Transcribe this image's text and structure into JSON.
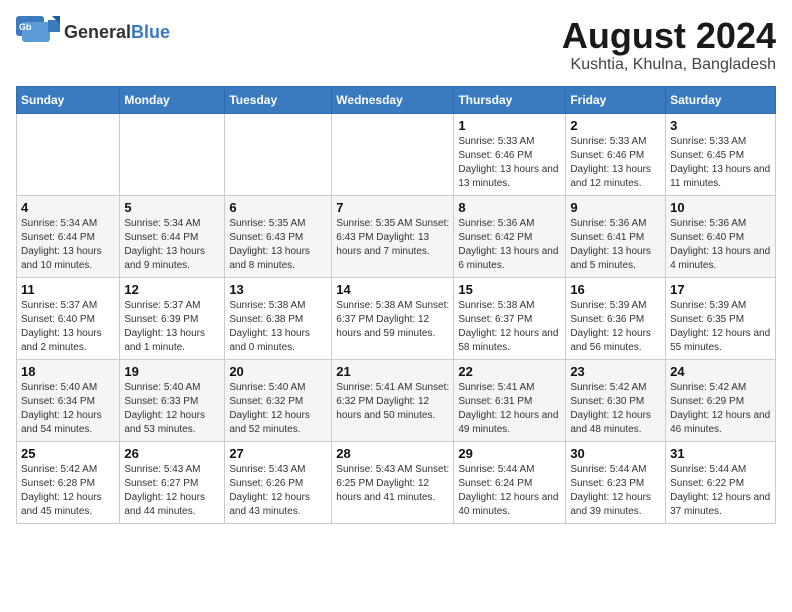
{
  "header": {
    "logo_line1": "General",
    "logo_line2": "Blue",
    "main_title": "August 2024",
    "subtitle": "Kushtia, Khulna, Bangladesh"
  },
  "days_of_week": [
    "Sunday",
    "Monday",
    "Tuesday",
    "Wednesday",
    "Thursday",
    "Friday",
    "Saturday"
  ],
  "weeks": [
    [
      {
        "date": "",
        "info": ""
      },
      {
        "date": "",
        "info": ""
      },
      {
        "date": "",
        "info": ""
      },
      {
        "date": "",
        "info": ""
      },
      {
        "date": "1",
        "info": "Sunrise: 5:33 AM\nSunset: 6:46 PM\nDaylight: 13 hours\nand 13 minutes."
      },
      {
        "date": "2",
        "info": "Sunrise: 5:33 AM\nSunset: 6:46 PM\nDaylight: 13 hours\nand 12 minutes."
      },
      {
        "date": "3",
        "info": "Sunrise: 5:33 AM\nSunset: 6:45 PM\nDaylight: 13 hours\nand 11 minutes."
      }
    ],
    [
      {
        "date": "4",
        "info": "Sunrise: 5:34 AM\nSunset: 6:44 PM\nDaylight: 13 hours\nand 10 minutes."
      },
      {
        "date": "5",
        "info": "Sunrise: 5:34 AM\nSunset: 6:44 PM\nDaylight: 13 hours\nand 9 minutes."
      },
      {
        "date": "6",
        "info": "Sunrise: 5:35 AM\nSunset: 6:43 PM\nDaylight: 13 hours\nand 8 minutes."
      },
      {
        "date": "7",
        "info": "Sunrise: 5:35 AM\nSunset: 6:43 PM\nDaylight: 13 hours\nand 7 minutes."
      },
      {
        "date": "8",
        "info": "Sunrise: 5:36 AM\nSunset: 6:42 PM\nDaylight: 13 hours\nand 6 minutes."
      },
      {
        "date": "9",
        "info": "Sunrise: 5:36 AM\nSunset: 6:41 PM\nDaylight: 13 hours\nand 5 minutes."
      },
      {
        "date": "10",
        "info": "Sunrise: 5:36 AM\nSunset: 6:40 PM\nDaylight: 13 hours\nand 4 minutes."
      }
    ],
    [
      {
        "date": "11",
        "info": "Sunrise: 5:37 AM\nSunset: 6:40 PM\nDaylight: 13 hours\nand 2 minutes."
      },
      {
        "date": "12",
        "info": "Sunrise: 5:37 AM\nSunset: 6:39 PM\nDaylight: 13 hours\nand 1 minute."
      },
      {
        "date": "13",
        "info": "Sunrise: 5:38 AM\nSunset: 6:38 PM\nDaylight: 13 hours\nand 0 minutes."
      },
      {
        "date": "14",
        "info": "Sunrise: 5:38 AM\nSunset: 6:37 PM\nDaylight: 12 hours\nand 59 minutes."
      },
      {
        "date": "15",
        "info": "Sunrise: 5:38 AM\nSunset: 6:37 PM\nDaylight: 12 hours\nand 58 minutes."
      },
      {
        "date": "16",
        "info": "Sunrise: 5:39 AM\nSunset: 6:36 PM\nDaylight: 12 hours\nand 56 minutes."
      },
      {
        "date": "17",
        "info": "Sunrise: 5:39 AM\nSunset: 6:35 PM\nDaylight: 12 hours\nand 55 minutes."
      }
    ],
    [
      {
        "date": "18",
        "info": "Sunrise: 5:40 AM\nSunset: 6:34 PM\nDaylight: 12 hours\nand 54 minutes."
      },
      {
        "date": "19",
        "info": "Sunrise: 5:40 AM\nSunset: 6:33 PM\nDaylight: 12 hours\nand 53 minutes."
      },
      {
        "date": "20",
        "info": "Sunrise: 5:40 AM\nSunset: 6:32 PM\nDaylight: 12 hours\nand 52 minutes."
      },
      {
        "date": "21",
        "info": "Sunrise: 5:41 AM\nSunset: 6:32 PM\nDaylight: 12 hours\nand 50 minutes."
      },
      {
        "date": "22",
        "info": "Sunrise: 5:41 AM\nSunset: 6:31 PM\nDaylight: 12 hours\nand 49 minutes."
      },
      {
        "date": "23",
        "info": "Sunrise: 5:42 AM\nSunset: 6:30 PM\nDaylight: 12 hours\nand 48 minutes."
      },
      {
        "date": "24",
        "info": "Sunrise: 5:42 AM\nSunset: 6:29 PM\nDaylight: 12 hours\nand 46 minutes."
      }
    ],
    [
      {
        "date": "25",
        "info": "Sunrise: 5:42 AM\nSunset: 6:28 PM\nDaylight: 12 hours\nand 45 minutes."
      },
      {
        "date": "26",
        "info": "Sunrise: 5:43 AM\nSunset: 6:27 PM\nDaylight: 12 hours\nand 44 minutes."
      },
      {
        "date": "27",
        "info": "Sunrise: 5:43 AM\nSunset: 6:26 PM\nDaylight: 12 hours\nand 43 minutes."
      },
      {
        "date": "28",
        "info": "Sunrise: 5:43 AM\nSunset: 6:25 PM\nDaylight: 12 hours\nand 41 minutes."
      },
      {
        "date": "29",
        "info": "Sunrise: 5:44 AM\nSunset: 6:24 PM\nDaylight: 12 hours\nand 40 minutes."
      },
      {
        "date": "30",
        "info": "Sunrise: 5:44 AM\nSunset: 6:23 PM\nDaylight: 12 hours\nand 39 minutes."
      },
      {
        "date": "31",
        "info": "Sunrise: 5:44 AM\nSunset: 6:22 PM\nDaylight: 12 hours\nand 37 minutes."
      }
    ]
  ]
}
